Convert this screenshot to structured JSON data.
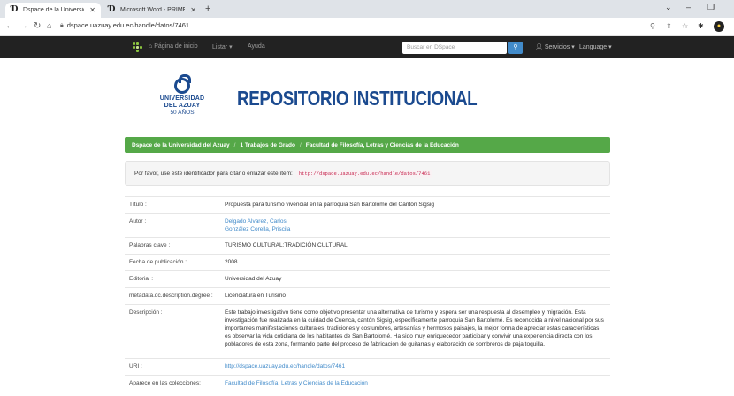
{
  "browser": {
    "tabs": [
      {
        "title": "Dspace de la Universidad del Azu",
        "active": true
      },
      {
        "title": "Microsoft Word - PRIMERA PART",
        "active": false
      }
    ],
    "new_tab": "+",
    "window_controls": {
      "collapse": "⌄",
      "minimize": "–",
      "restore": "❐"
    },
    "url": "dspace.uazuay.edu.ec/handle/datos/7461",
    "profile_initial": "●"
  },
  "site_nav": {
    "home": "Página de inicio",
    "list": "Listar",
    "help": "Ayuda",
    "search_placeholder": "Buscar en DSpace",
    "services": "Servicios",
    "language": "Language"
  },
  "header": {
    "logo_line1": "UNIVERSIDAD",
    "logo_line2": "DEL AZUAY",
    "logo_line3": "50 AÑOS",
    "title": "REPOSITORIO INSTITUCIONAL"
  },
  "breadcrumb": [
    "Dspace de la Universidad del Azuay",
    "1 Trabajos de Grado",
    "Facultad de Filosofía, Letras y Ciencias de la Educación"
  ],
  "identifier": {
    "text": "Por favor, use este identificador para citar o enlazar este ítem:",
    "uri": "http://dspace.uazuay.edu.ec/handle/datos/7461"
  },
  "metadata": {
    "title_label": "Título :",
    "title_value": "Propuesta para turismo vivencial en la parroquia San Bartolomé del Cantón Sigsig",
    "author_label": "Autor :",
    "author_1": "Delgado Alvarez, Carlos",
    "author_2": "González Corella, Priscila",
    "keywords_label": "Palabras clave :",
    "keywords_value": "TURISMO CULTURAL;TRADICIÓN CULTURAL",
    "date_label": "Fecha de publicación :",
    "date_value": "2008",
    "publisher_label": "Editorial :",
    "publisher_value": "Universidad del Azuay",
    "degree_label": "metadata.dc.description.degree :",
    "degree_value": "Licenciatura en Turismo",
    "description_label": "Descripción :",
    "description_value": "Este trabajo investigativo tiene como objetivo presentar una alternativa de turismo y espera ser una respuesta al desempleo y migración. Esta investigación fue realizada en la cuidad de Cuenca, cantón Sigsig, específicamente parroquia San Bartolomé. Es reconocida a nivel nacional por sus importantes manifestaciones culturales, tradiciones y costumbres, artesanías y hermosos paisajes, la mejor forma de apreciar estas características es observar la vida cotidiana de los habitantes de San Bartolomé. Ha sido muy enriquecedor participar y convivir una experiencia directa con los pobladores de esta zona, formando parte del proceso de fabricación de guitarras y elaboración de sombreros de paja toquilla.",
    "uri_label": "URI :",
    "uri_value": "http://dspace.uazuay.edu.ec/handle/datos/7461",
    "collections_label": "Aparece en las colecciones:",
    "collections_value": "Facultad de Filosofía, Letras y Ciencias de la Educación"
  }
}
